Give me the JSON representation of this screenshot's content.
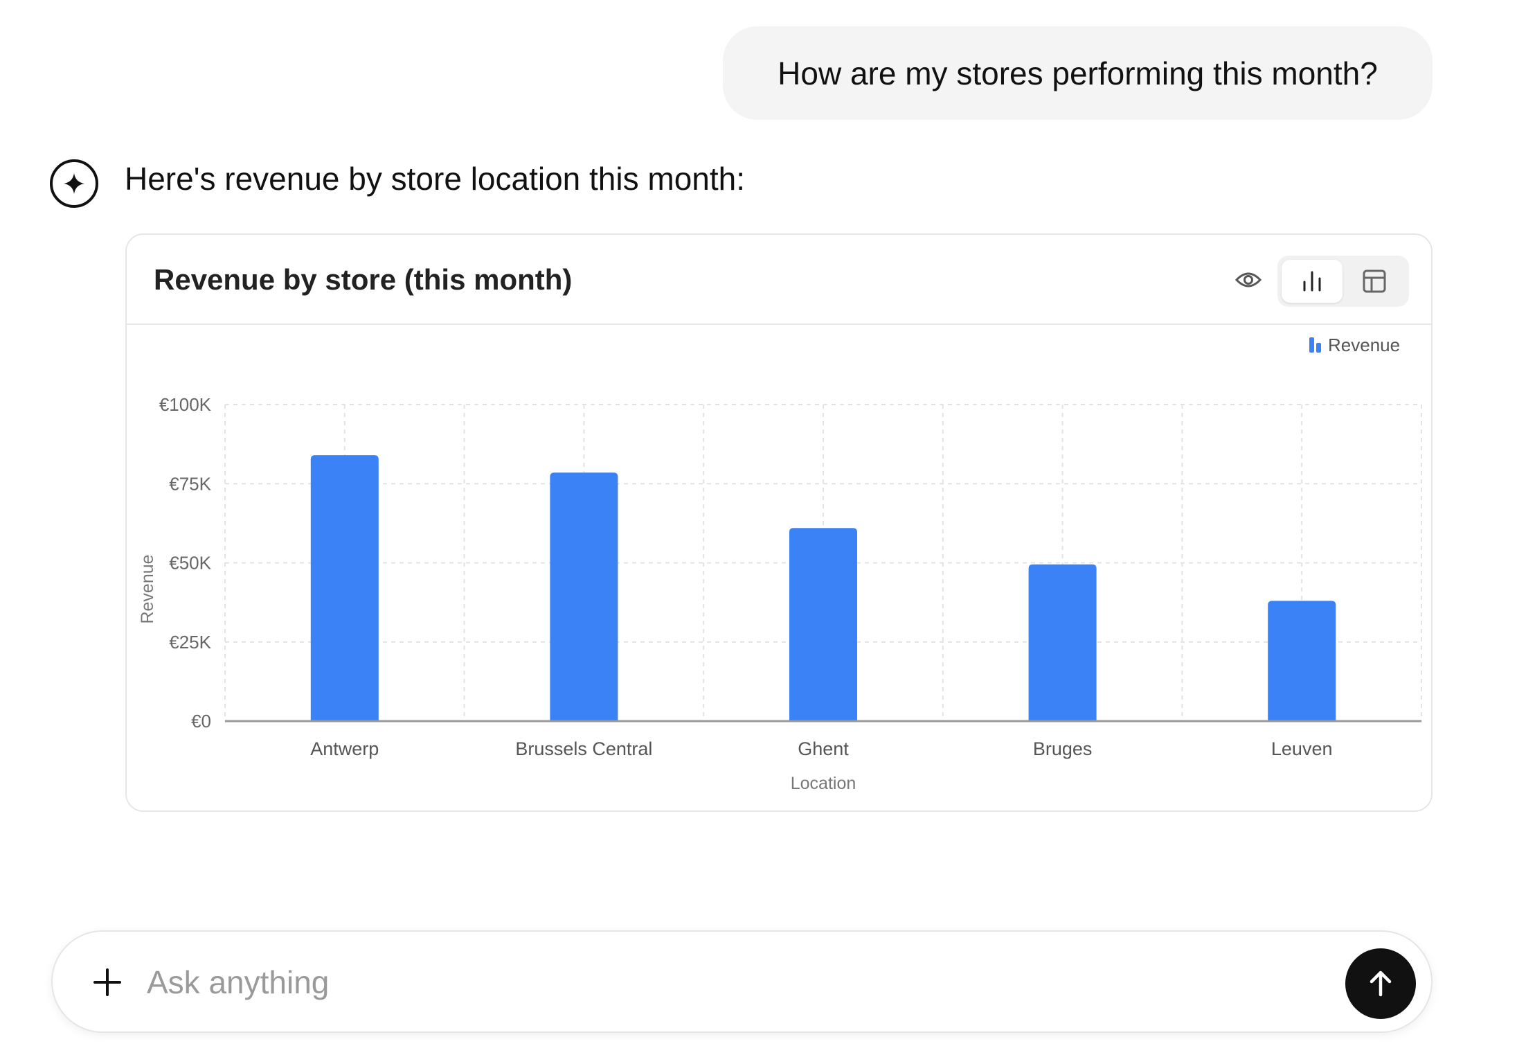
{
  "conversation": {
    "user_message": "How are my stores performing this month?",
    "assistant_message": "Here's revenue by store location this month:"
  },
  "card": {
    "title": "Revenue by store (this month)",
    "icons": {
      "preview": "eye-icon",
      "chart_view": "bar-chart-icon",
      "table_view": "table-icon"
    }
  },
  "chart_data": {
    "type": "bar",
    "categories": [
      "Antwerp",
      "Brussels Central",
      "Ghent",
      "Bruges",
      "Leuven"
    ],
    "series": [
      {
        "name": "Revenue",
        "values": [
          84000,
          78500,
          61000,
          49500,
          38000
        ],
        "color": "#3b82f6"
      }
    ],
    "xlabel": "Location",
    "ylabel": "Revenue",
    "ylim": [
      0,
      100000
    ],
    "yticks": [
      0,
      25000,
      50000,
      75000,
      100000
    ],
    "ytick_labels": [
      "€0",
      "€25K",
      "€50K",
      "€75K",
      "€100K"
    ],
    "grid": true,
    "legend": "top-right"
  },
  "composer": {
    "placeholder": "Ask anything",
    "icons": {
      "attach": "plus-icon",
      "send": "arrow-up-icon"
    }
  },
  "colors": {
    "accent": "#3b82f6",
    "send_button": "#111111",
    "user_bubble": "#f4f4f4"
  }
}
